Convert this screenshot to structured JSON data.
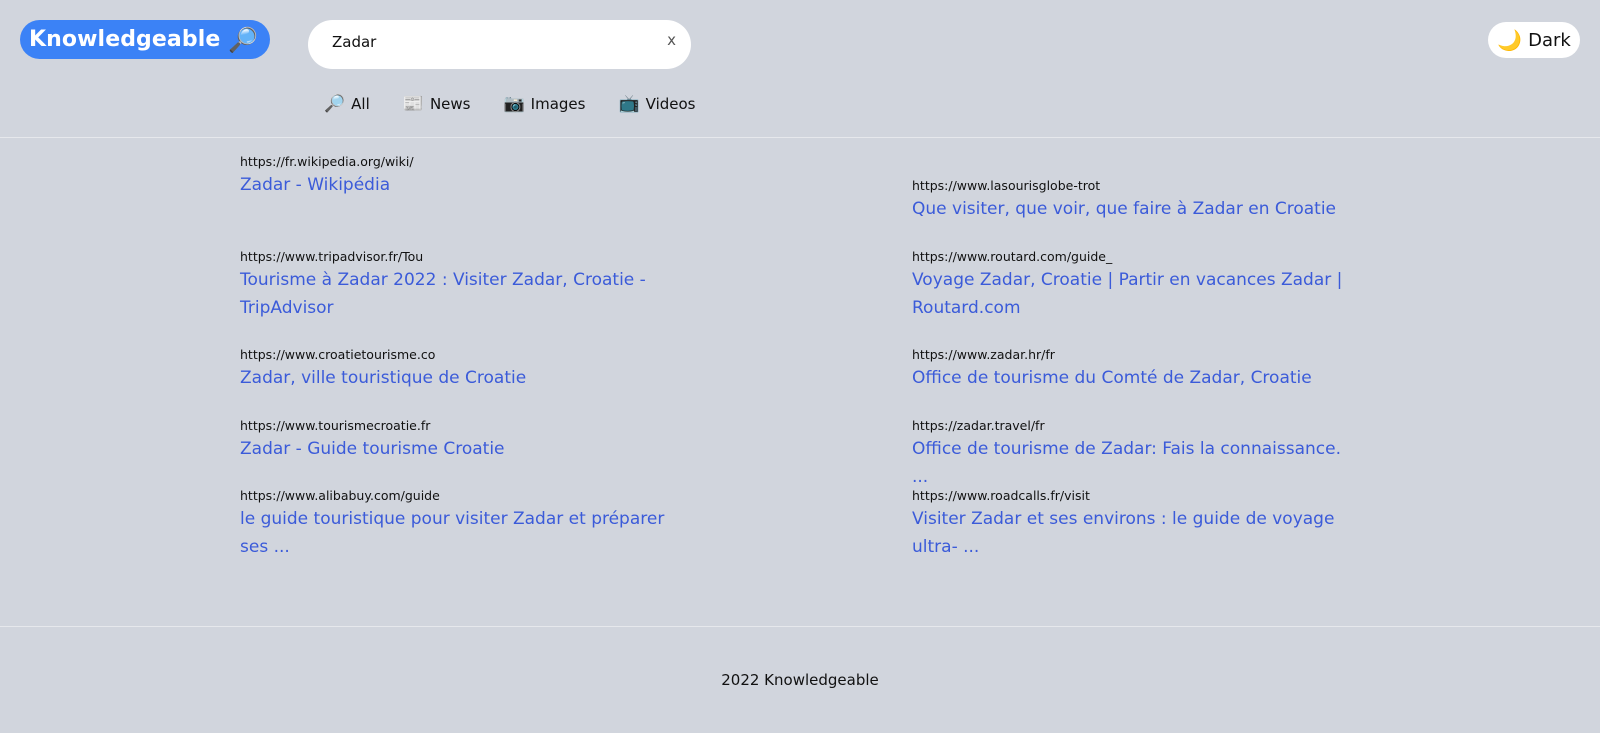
{
  "header": {
    "logo_text": "Knowledgeable",
    "logo_icon": "🔎",
    "search": {
      "value": "Zadar",
      "clear_label": "x"
    },
    "theme_toggle": {
      "icon": "🌙",
      "label": "Dark"
    },
    "tabs": [
      {
        "icon": "🔎",
        "label": "All"
      },
      {
        "icon": "📰",
        "label": "News"
      },
      {
        "icon": "📷",
        "label": "Images"
      },
      {
        "icon": "📺",
        "label": "Videos"
      }
    ]
  },
  "results": {
    "left": [
      {
        "url": "https://fr.wikipedia.org/wiki/",
        "title": "Zadar - Wikipédia"
      },
      {
        "url": "https://www.tripadvisor.fr/Tou",
        "title": "Tourisme à Zadar 2022 : Visiter Zadar, Croatie - TripAdvisor"
      },
      {
        "url": "https://www.croatietourisme.co",
        "title": "Zadar, ville touristique de Croatie"
      },
      {
        "url": "https://www.tourismecroatie.fr",
        "title": "Zadar - Guide tourisme Croatie"
      },
      {
        "url": "https://www.alibabuy.com/guide",
        "title": "le guide touristique pour visiter Zadar et préparer ses ..."
      }
    ],
    "right": [
      {
        "url": "https://www.lasourisglobe-trot",
        "title": "Que visiter, que voir, que faire à Zadar en Croatie"
      },
      {
        "url": "https://www.routard.com/guide_",
        "title": "Voyage Zadar, Croatie | Partir en vacances Zadar | Routard.com"
      },
      {
        "url": "https://www.zadar.hr/fr",
        "title": "Office de tourisme du Comté de Zadar, Croatie"
      },
      {
        "url": "https://zadar.travel/fr",
        "title": "Office de tourisme de Zadar: Fais la connaissance. ..."
      },
      {
        "url": "https://www.roadcalls.fr/visit",
        "title": "Visiter Zadar et ses environs : le guide de voyage ultra- ..."
      }
    ]
  },
  "footer": {
    "text": "2022 Knowledgeable"
  }
}
